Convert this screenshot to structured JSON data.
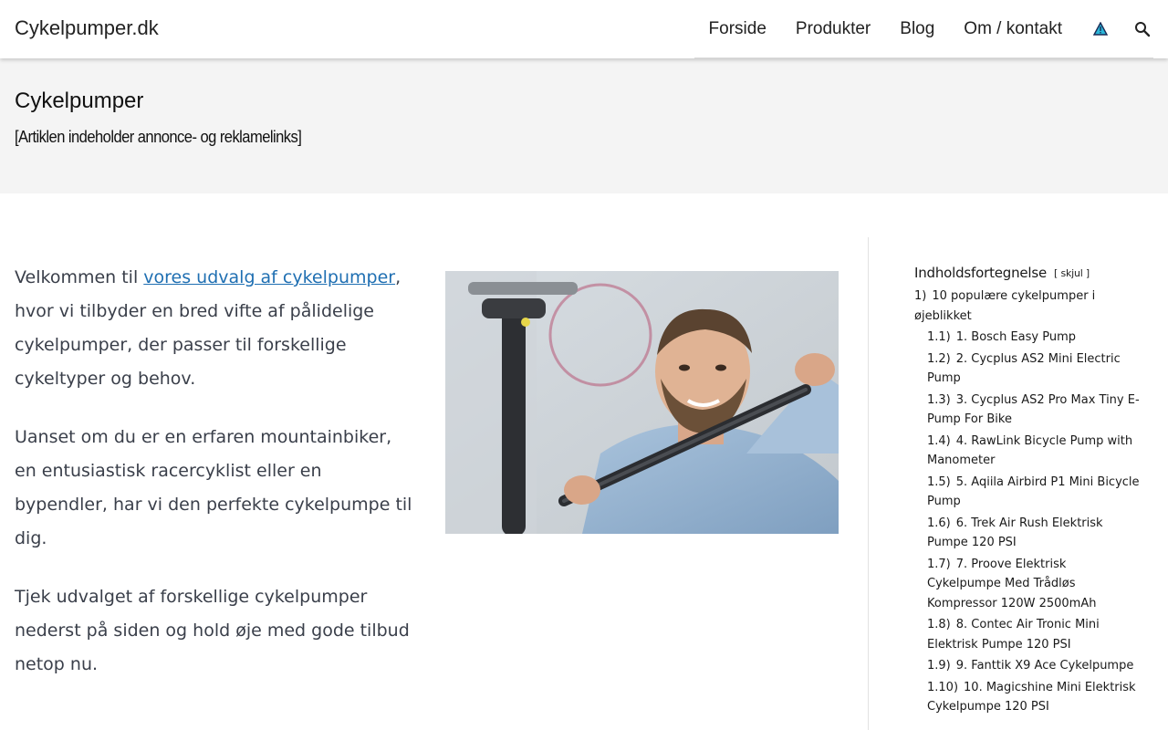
{
  "header": {
    "brand": "Cykelpumper.dk",
    "nav": [
      "Forside",
      "Produkter",
      "Blog",
      "Om / kontakt"
    ],
    "warning_icon": "warning-triangle-icon",
    "search_icon": "search-icon"
  },
  "page": {
    "title": "Cykelpumper",
    "disclaimer": "[Artiklen indeholder annonce- og reklamelinks]"
  },
  "intro": {
    "p1_before": "Velkommen til ",
    "p1_link": "vores udvalg af cykelpumper",
    "p1_after": ", hvor vi tilbyder en bred vifte af pålidelige cykelpumper, der passer til forskellige cykeltyper og behov.",
    "p2": "Uanset om du er en erfaren mountainbiker, en entusiastisk racercyklist eller en bypendler, har vi den perfekte cykelpumpe til dig.",
    "p3": "Tjek udvalget af forskellige cykelpumper nederst på siden og hold øje med gode tilbud netop nu."
  },
  "toc": {
    "title": "Indholdsfortegnelse",
    "toggle_open": "[",
    "toggle_label": "skjul",
    "toggle_close": "]",
    "items": [
      {
        "num": "1)",
        "label": "10 populære cykelpumper i øjeblikket"
      },
      {
        "num": "1.1)",
        "label": "1. Bosch Easy Pump"
      },
      {
        "num": "1.2)",
        "label": "2. Cycplus AS2 Mini Electric Pump"
      },
      {
        "num": "1.3)",
        "label": "3. Cycplus AS2 Pro Max Tiny E-Pump For Bike"
      },
      {
        "num": "1.4)",
        "label": "4. RawLink Bicycle Pump with Manometer"
      },
      {
        "num": "1.5)",
        "label": "5. Aqiila Airbird P1 Mini Bicycle Pump"
      },
      {
        "num": "1.6)",
        "label": "6. Trek Air Rush Elektrisk Pumpe 120 PSI"
      },
      {
        "num": "1.7)",
        "label": "7. Proove Elektrisk Cykelpumpe Med Trådløs Kompressor 120W 2500mAh"
      },
      {
        "num": "1.8)",
        "label": "8. Contec Air Tronic Mini Elektrisk Pumpe 120 PSI"
      },
      {
        "num": "1.9)",
        "label": "9. Fanttik X9 Ace Cykelpumpe"
      },
      {
        "num": "1.10)",
        "label": "10. Magicshine Mini Elektrisk Cykelpumpe 120 PSI"
      }
    ]
  },
  "colors": {
    "link": "#1f6fb2",
    "body_text": "#3a3f4a",
    "band_bg": "#f4f4f4"
  }
}
